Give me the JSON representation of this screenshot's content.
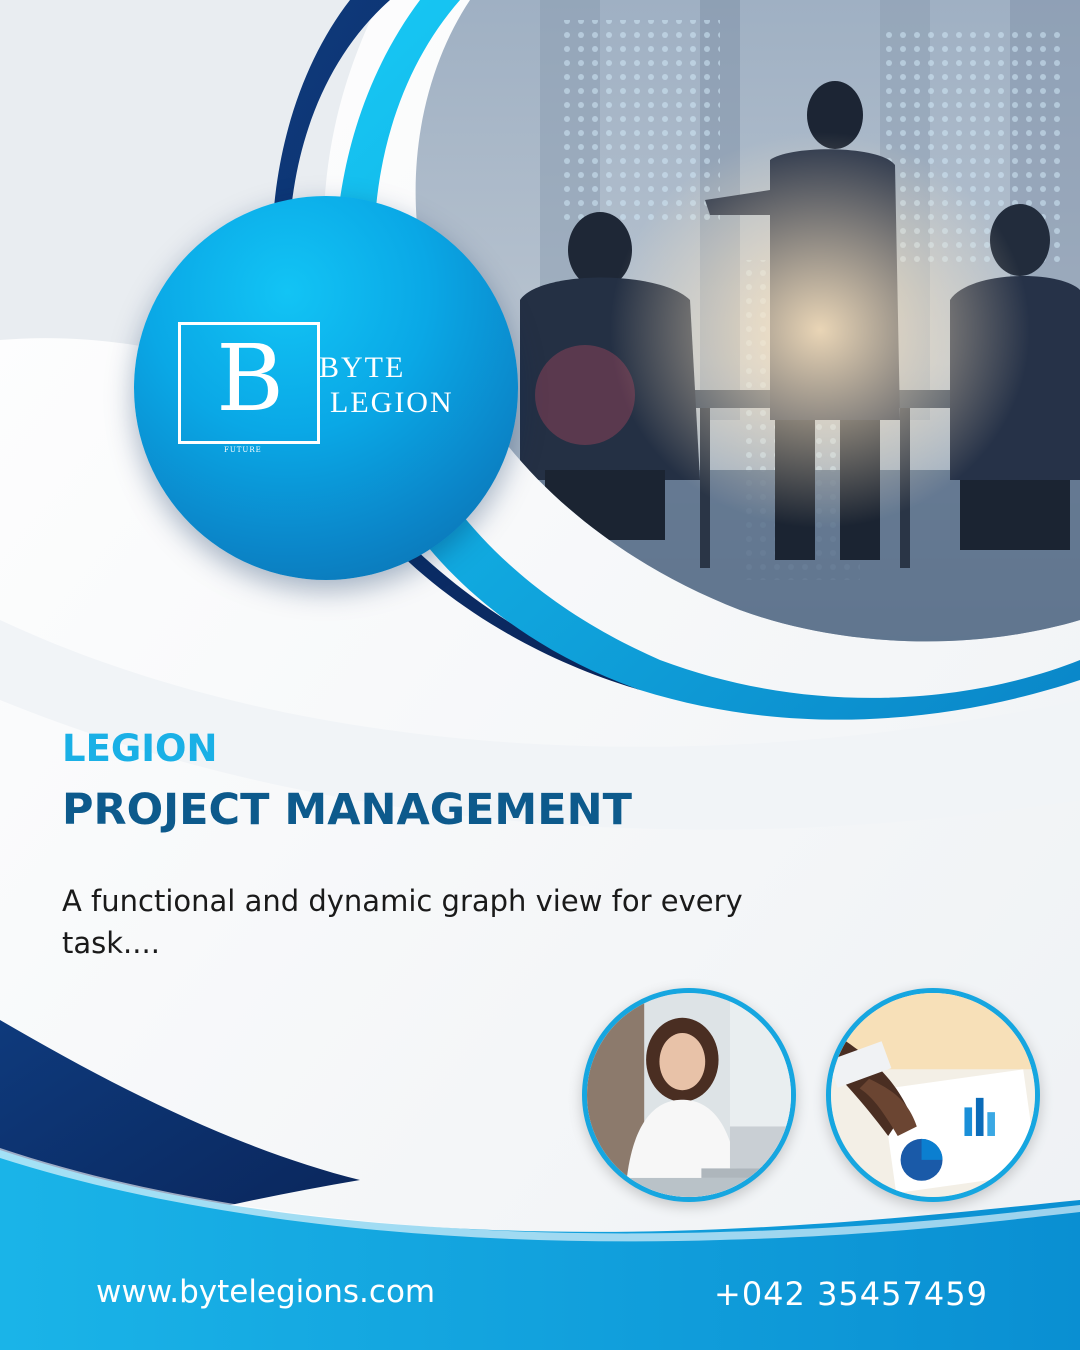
{
  "brand": {
    "logo_letter": "B",
    "logo_word_1": "BYTE",
    "logo_word_2": "LEGION",
    "logo_small_text": "FUTURE"
  },
  "headline": {
    "line_1": "LEGION",
    "line_2": "PROJECT MANAGEMENT"
  },
  "tagline": "A functional and dynamic graph view for every task....",
  "footer": {
    "website": "www.bytelegions.com",
    "phone": "+042 35457459"
  },
  "colors": {
    "accent_light": "#1ab0e6",
    "accent_dark": "#0d5a8c",
    "brand_blue": "#0b86c9",
    "navy": "#0d2d6b"
  },
  "icons": [
    "logo-monogram",
    "meeting-photo",
    "businesswoman-photo",
    "chart-analysis-photo"
  ]
}
